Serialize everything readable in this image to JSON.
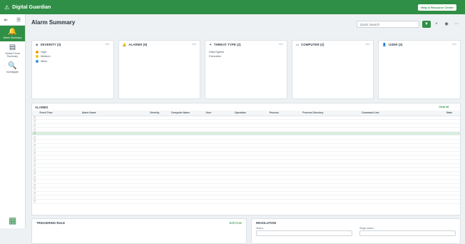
{
  "topbar": {
    "brand": "Digital Guardian",
    "help_label": "Help & Resource Center",
    "user_name": "",
    "user_role": ""
  },
  "sidebar": {
    "items": [
      {
        "label": "Alarm Summary",
        "icon": "bell-icon"
      },
      {
        "label": "Global Trend Summary",
        "icon": "chart-icon"
      },
      {
        "label": "Investigate",
        "icon": "search-person-icon"
      }
    ]
  },
  "header": {
    "title": "Alarm Summary",
    "subtitle": "",
    "search_placeholder": "Quick Search"
  },
  "cards": {
    "severity": {
      "title": "SEVERITY (3)",
      "items": [
        {
          "label": "High",
          "count": "",
          "color": "#f39c12"
        },
        {
          "label": "Medium",
          "count": "",
          "color": "#f1c40f"
        },
        {
          "label": "Minor",
          "count": "",
          "color": "#3498db"
        }
      ]
    },
    "alarms": {
      "title": "ALARMS (9)",
      "items": [
        {
          "label": "",
          "count": ""
        },
        {
          "label": "",
          "count": ""
        },
        {
          "label": "",
          "count": ""
        },
        {
          "label": "",
          "count": ""
        },
        {
          "label": "",
          "count": ""
        },
        {
          "label": "",
          "count": ""
        },
        {
          "label": "",
          "count": ""
        },
        {
          "label": "",
          "count": ""
        },
        {
          "label": "",
          "count": ""
        }
      ]
    },
    "threat": {
      "title": "THREAT TYPE (2)",
      "items": [
        {
          "label": "Data Egress",
          "count": ""
        },
        {
          "label": "Execution",
          "count": ""
        }
      ]
    },
    "computer": {
      "title": "COMPUTER (2)",
      "items": [
        {
          "label": "",
          "count": ""
        },
        {
          "label": "",
          "count": ""
        }
      ]
    },
    "user": {
      "title": "USER (3)",
      "items": [
        {
          "label": "",
          "count": ""
        },
        {
          "label": "",
          "count": ""
        },
        {
          "label": "",
          "count": ""
        }
      ]
    }
  },
  "alarms_table": {
    "title": "ALARMS",
    "toolbar": {
      "export": "",
      "classify": "",
      "assign": "",
      "clear_all": "Clear all"
    },
    "columns": [
      "Event Time",
      "Alarm Name",
      "Severity",
      "Computer Name",
      "User",
      "Operation",
      "Process",
      "Process Directory",
      "Command Line",
      "State"
    ],
    "rows": [
      [
        "",
        "",
        "",
        "",
        "",
        "",
        "",
        "",
        "",
        ""
      ],
      [
        "",
        "",
        "",
        "",
        "",
        "",
        "",
        "",
        "",
        ""
      ],
      [
        "",
        "",
        "",
        "",
        "",
        "",
        "",
        "",
        "",
        ""
      ],
      [
        "",
        "",
        "",
        "",
        "",
        "",
        "",
        "",
        "",
        ""
      ],
      [
        "",
        "",
        "",
        "",
        "",
        "",
        "",
        "",
        "",
        ""
      ],
      [
        "",
        "",
        "",
        "",
        "",
        "",
        "",
        "",
        "",
        ""
      ],
      [
        "",
        "",
        "",
        "",
        "",
        "",
        "",
        "",
        "",
        ""
      ],
      [
        "",
        "",
        "",
        "",
        "",
        "",
        "",
        "",
        "",
        ""
      ],
      [
        "",
        "",
        "",
        "",
        "",
        "",
        "",
        "",
        "",
        ""
      ],
      [
        "",
        "",
        "",
        "",
        "",
        "",
        "",
        "",
        "",
        ""
      ],
      [
        "",
        "",
        "",
        "",
        "",
        "",
        "",
        "",
        "",
        ""
      ],
      [
        "",
        "",
        "",
        "",
        "",
        "",
        "",
        "",
        "",
        ""
      ],
      [
        "",
        "",
        "",
        "",
        "",
        "",
        "",
        "",
        "",
        ""
      ],
      [
        "",
        "",
        "",
        "",
        "",
        "",
        "",
        "",
        "",
        ""
      ],
      [
        "",
        "",
        "",
        "",
        "",
        "",
        "",
        "",
        "",
        ""
      ],
      [
        "",
        "",
        "",
        "",
        "",
        "",
        "",
        "",
        "",
        ""
      ],
      [
        "",
        "",
        "",
        "",
        "",
        "",
        "",
        "",
        "",
        ""
      ],
      [
        "",
        "",
        "",
        "",
        "",
        "",
        "",
        "",
        "",
        ""
      ],
      [
        "",
        "",
        "",
        "",
        "",
        "",
        "",
        "",
        "",
        ""
      ],
      [
        "",
        "",
        "",
        "",
        "",
        "",
        "",
        "",
        "",
        ""
      ],
      [
        "",
        "",
        "",
        "",
        "",
        "",
        "",
        "",
        "",
        ""
      ],
      [
        "",
        "",
        "",
        "",
        "",
        "",
        "",
        "",
        "",
        ""
      ]
    ],
    "selected_row": 4
  },
  "triggering_rule": {
    "title": "TRIGGERING RULE",
    "edit_label": "Edit Rule",
    "rule_text": ""
  },
  "resolution": {
    "title": "RESOLUTION",
    "status_label": "Status",
    "stage_label": "Stage status",
    "status_value": "",
    "stage_value": ""
  },
  "colors": {
    "brand": "#2f8f46",
    "selected_row": "#d8eedf"
  }
}
